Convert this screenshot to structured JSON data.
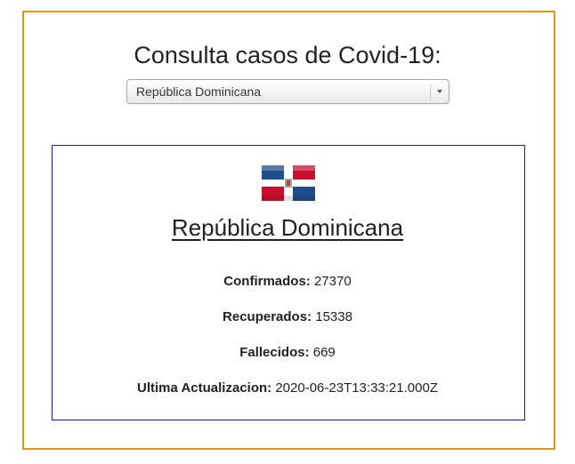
{
  "header": {
    "title": "Consulta casos de Covid-19:"
  },
  "country_select": {
    "selected": "República Dominicana"
  },
  "card": {
    "flag": "dominican-republic-flag-icon",
    "country_name": "República Dominicana",
    "stats": {
      "confirmed_label": "Confirmados:",
      "confirmed_value": "27370",
      "recovered_label": "Recuperados:",
      "recovered_value": "15338",
      "deaths_label": "Fallecidos:",
      "deaths_value": "669",
      "updated_label": "Ultima Actualizacion:",
      "updated_value": "2020-06-23T13:33:21.000Z"
    }
  },
  "colors": {
    "outer_border": "#d99a1c",
    "card_border": "#1a1aa8",
    "flag_blue": "#1f4e8c",
    "flag_red": "#c8102e"
  }
}
